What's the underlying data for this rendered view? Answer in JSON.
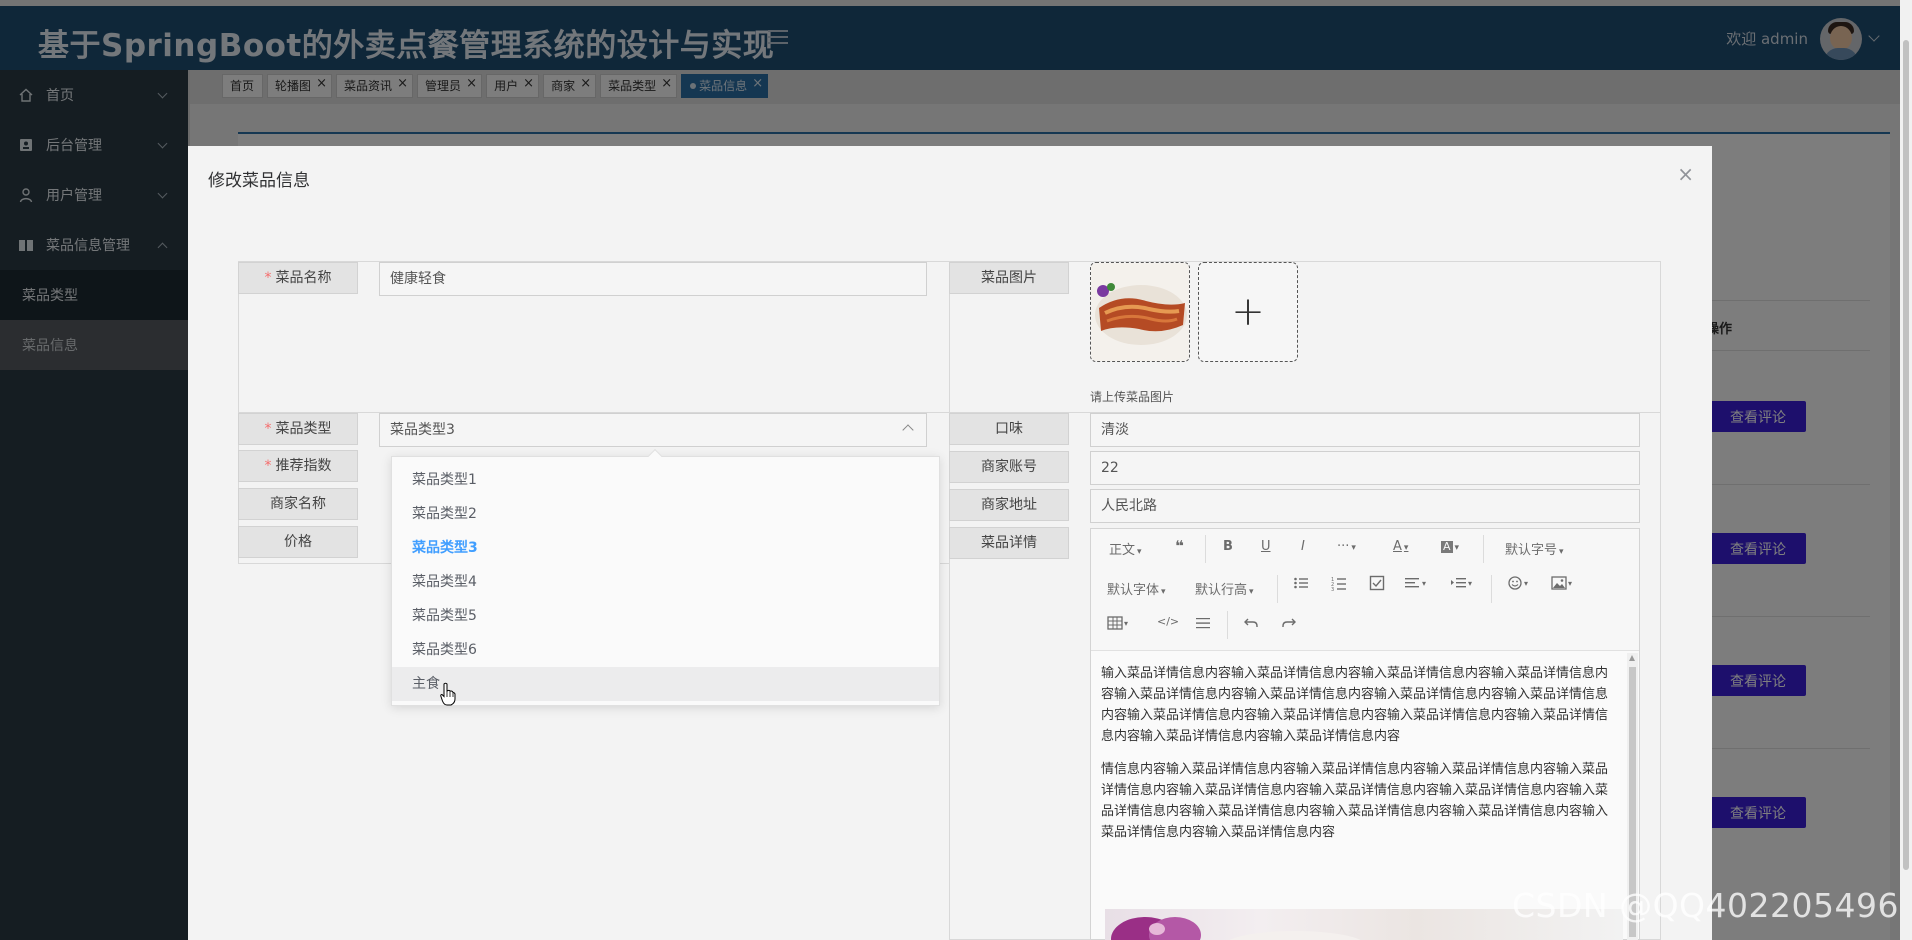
{
  "header": {
    "title": "基于SpringBoot的外卖点餐管理系统的设计与实现",
    "welcome": "欢迎 admin"
  },
  "sidebar": {
    "items": [
      {
        "label": "首页",
        "icon": "home-icon"
      },
      {
        "label": "后台管理",
        "icon": "id-card-icon"
      },
      {
        "label": "用户管理",
        "icon": "user-icon"
      },
      {
        "label": "菜品信息管理",
        "icon": "book-icon"
      }
    ],
    "subitems": [
      {
        "label": "菜品类型"
      },
      {
        "label": "菜品信息"
      }
    ]
  },
  "tabs": [
    {
      "label": "首页"
    },
    {
      "label": "轮播图"
    },
    {
      "label": "菜品资讯"
    },
    {
      "label": "管理员"
    },
    {
      "label": "用户"
    },
    {
      "label": "商家"
    },
    {
      "label": "菜品类型"
    },
    {
      "label": "菜品信息"
    }
  ],
  "background": {
    "column_header": "操作",
    "review_button": "查看评论"
  },
  "modal": {
    "title": "修改菜品信息",
    "close": "×",
    "fields": {
      "name": {
        "label": "菜品名称",
        "value": "健康轻食"
      },
      "image": {
        "label": "菜品图片",
        "hint": "请上传菜品图片",
        "add": "+"
      },
      "type": {
        "label": "菜品类型",
        "value": "菜品类型3"
      },
      "flavor": {
        "label": "口味",
        "value": "清淡"
      },
      "recommend": {
        "label": "推荐指数"
      },
      "merchant_account": {
        "label": "商家账号",
        "value": "22"
      },
      "merchant_name": {
        "label": "商家名称"
      },
      "merchant_address": {
        "label": "商家地址",
        "value": "人民北路"
      },
      "price": {
        "label": "价格"
      },
      "detail": {
        "label": "菜品详情"
      }
    },
    "required_mark": "*"
  },
  "dropdown": {
    "options": [
      "菜品类型1",
      "菜品类型2",
      "菜品类型3",
      "菜品类型4",
      "菜品类型5",
      "菜品类型6",
      "主食"
    ],
    "selected": "菜品类型3",
    "hovered": "主食"
  },
  "editor": {
    "toolbar": {
      "paragraph": "正文",
      "quote": "❝",
      "bold": "B",
      "underline": "U",
      "italic": "I",
      "more": "···",
      "font_color": "A",
      "bg_color": "A",
      "font_size": "默认字号",
      "font_family": "默认字体",
      "line_height": "默认行高",
      "code": "</>"
    },
    "paragraphs": [
      "输入菜品详情信息内容输入菜品详情信息内容输入菜品详情信息内容输入菜品详情信息内容输入菜品详情信息内容输入菜品详情信息内容输入菜品详情信息内容输入菜品详情信息内容输入菜品详情信息内容输入菜品详情信息内容输入菜品详情信息内容输入菜品详情信息内容输入菜品详情信息内容输入菜品详情信息内容",
      "情信息内容输入菜品详情信息内容输入菜品详情信息内容输入菜品详情信息内容输入菜品详情信息内容输入菜品详情信息内容输入菜品详情信息内容输入菜品详情信息内容输入菜品详情信息内容输入菜品详情信息内容输入菜品详情信息内容输入菜品详情信息内容输入菜品详情信息内容输入菜品详情信息内容"
    ]
  },
  "watermark": "CSDN @QQ402205496"
}
